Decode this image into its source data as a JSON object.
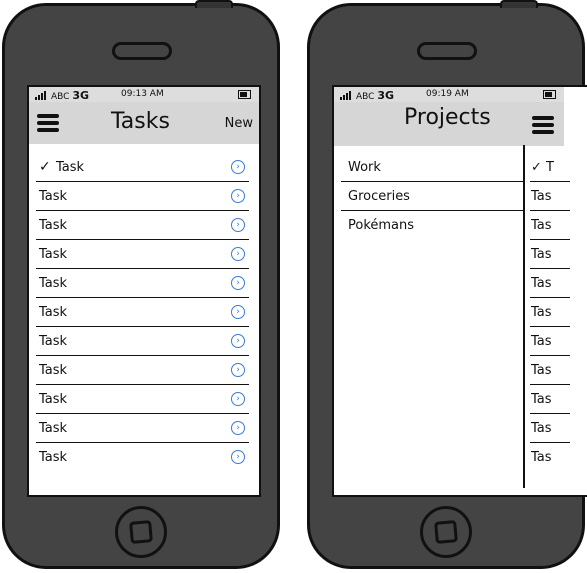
{
  "left_phone": {
    "status": {
      "carrier": "ABC",
      "network": "3G",
      "time": "09:13 AM"
    },
    "title": "Tasks",
    "new_button": "New",
    "tasks": [
      {
        "label": "Task",
        "checked": true
      },
      {
        "label": "Task",
        "checked": false
      },
      {
        "label": "Task",
        "checked": false
      },
      {
        "label": "Task",
        "checked": false
      },
      {
        "label": "Task",
        "checked": false
      },
      {
        "label": "Task",
        "checked": false
      },
      {
        "label": "Task",
        "checked": false
      },
      {
        "label": "Task",
        "checked": false
      },
      {
        "label": "Task",
        "checked": false
      },
      {
        "label": "Task",
        "checked": false
      },
      {
        "label": "Task",
        "checked": false
      }
    ]
  },
  "right_phone": {
    "status": {
      "carrier": "ABC",
      "network": "3G",
      "time": "09:19 AM"
    },
    "title": "Projects",
    "projects": [
      "Work",
      "Groceries",
      "Pokémans"
    ],
    "background_tasks": [
      "✓ T",
      "Tas",
      "Tas",
      "Tas",
      "Tas",
      "Tas",
      "Tas",
      "Tas",
      "Tas",
      "Tas",
      "Tas"
    ]
  },
  "colors": {
    "accent": "#3a7bd5",
    "body": "#444444",
    "navbar": "#d6d6d6"
  },
  "icons": {
    "menu": "hamburger-icon",
    "detail": "chevron-circle-right-icon",
    "check": "checkmark-icon"
  }
}
